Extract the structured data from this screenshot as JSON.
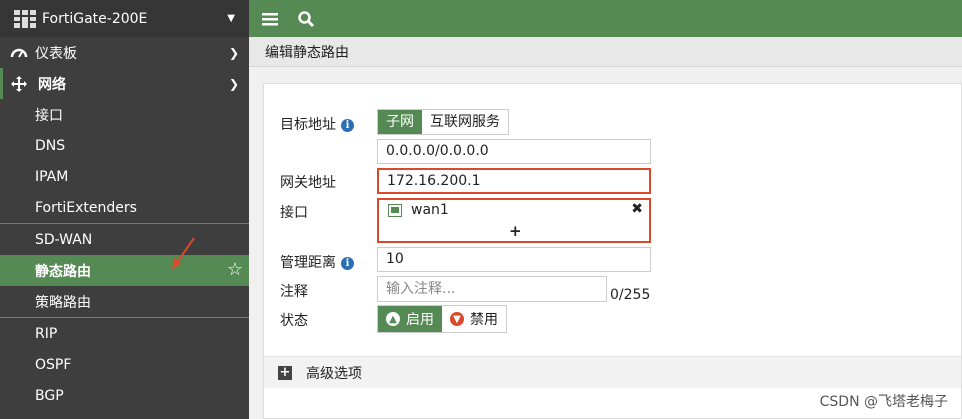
{
  "sidebar": {
    "device_name": "FortiGate-200E",
    "items": [
      {
        "label": "仪表板"
      },
      {
        "label": "网络"
      },
      {
        "label": "接口"
      },
      {
        "label": "DNS"
      },
      {
        "label": "IPAM"
      },
      {
        "label": "FortiExtenders"
      },
      {
        "label": "SD-WAN"
      },
      {
        "label": "静态路由"
      },
      {
        "label": "策略路由"
      },
      {
        "label": "RIP"
      },
      {
        "label": "OSPF"
      },
      {
        "label": "BGP"
      }
    ]
  },
  "breadcrumb": "编辑静态路由",
  "form": {
    "destination_label": "目标地址",
    "dest_tabs": [
      "子网",
      "互联网服务"
    ],
    "dest_value": "0.0.0.0/0.0.0.0",
    "gateway_label": "网关地址",
    "gateway_value": "172.16.200.1",
    "interface_label": "接口",
    "interface_value": "wan1",
    "distance_label": "管理距离",
    "distance_value": "10",
    "comment_label": "注释",
    "comment_placeholder": "输入注释...",
    "comment_counter": "0/255",
    "status_label": "状态",
    "status_enable": "启用",
    "status_disable": "禁用",
    "advanced": "高级选项"
  },
  "watermark": "CSDN @飞塔老梅子",
  "colors": {
    "accent": "#558a55",
    "highlight": "#d9492a",
    "sidebar": "#3e3e3e"
  }
}
